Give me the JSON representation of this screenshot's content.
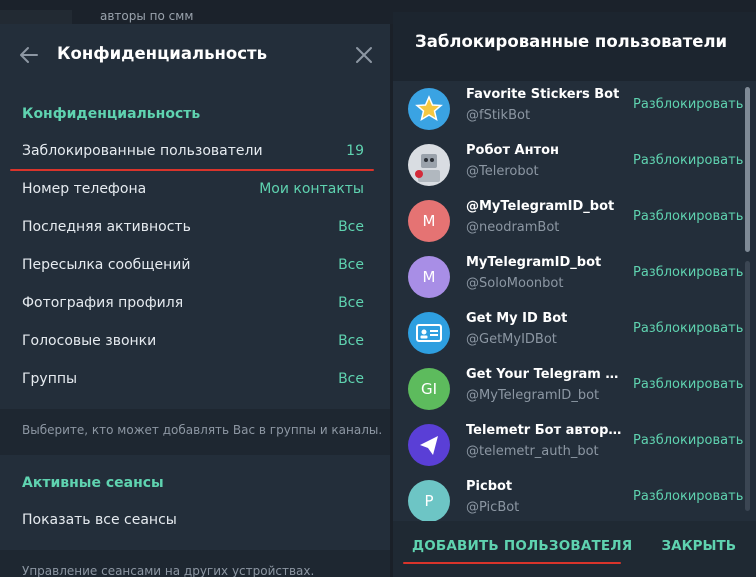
{
  "background": {
    "top_text": "авторы по смм",
    "bottom_text": "Управление сеансами на других устройствах."
  },
  "privacy": {
    "title": "Конфиденциальность",
    "section_label": "Конфиденциальность",
    "rows": [
      {
        "label": "Заблокированные пользователи",
        "value": "19"
      },
      {
        "label": "Номер телефона",
        "value": "Мои контакты"
      },
      {
        "label": "Последняя активность",
        "value": "Все"
      },
      {
        "label": "Пересылка сообщений",
        "value": "Все"
      },
      {
        "label": "Фотография профиля",
        "value": "Все"
      },
      {
        "label": "Голосовые звонки",
        "value": "Все"
      },
      {
        "label": "Группы",
        "value": "Все"
      }
    ],
    "groups_hint": "Выберите, кто может добавлять Вас в группы и каналы.",
    "sessions_section": "Активные сеансы",
    "show_sessions": "Показать все сеансы",
    "sessions_hint": "Управление сеансами на других устройствах."
  },
  "blocked": {
    "title": "Заблокированные пользователи",
    "unblock_label": "Разблокировать",
    "users": [
      {
        "name": "Favorite Stickers Bot",
        "handle": "@fStikBot",
        "avatar_icon": "star-sticker-icon",
        "avatar_color": "#3aa3e3"
      },
      {
        "name": "Робот Антон",
        "handle": "@Telerobot",
        "avatar_icon": "robot-photo-icon",
        "avatar_color": "#d9dde2"
      },
      {
        "name": "@MyTelegramID_bot",
        "handle": "@neodramBot",
        "avatar_letter": "M",
        "avatar_color": "#e57373"
      },
      {
        "name": "MyTelegramID_bot",
        "handle": "@SoloMoonbot",
        "avatar_letter": "M",
        "avatar_color": "#a88ee6"
      },
      {
        "name": "Get My ID Bot",
        "handle": "@GetMyIDBot",
        "avatar_icon": "id-card-icon",
        "avatar_color": "#2e9fe0"
      },
      {
        "name": "Get Your Telegram User ID",
        "handle": "@MyTelegramID_bot",
        "avatar_letter": "GI",
        "avatar_color": "#5dbb5d"
      },
      {
        "name": "Telemetr Бот авторизации",
        "handle": "@telemetr_auth_bot",
        "avatar_icon": "paper-plane-icon",
        "avatar_color": "#5a3fd6"
      },
      {
        "name": "Picbot",
        "handle": "@PicBot",
        "avatar_letter": "P",
        "avatar_color": "#6dc5c5"
      }
    ],
    "add_button": "ДОБАВИТЬ ПОЛЬЗОВАТЕЛЯ",
    "close_button": "ЗАКРЫТЬ"
  },
  "colors": {
    "accent": "#5fd3b0",
    "underline": "#d9342b",
    "panel": "#232e3a"
  }
}
